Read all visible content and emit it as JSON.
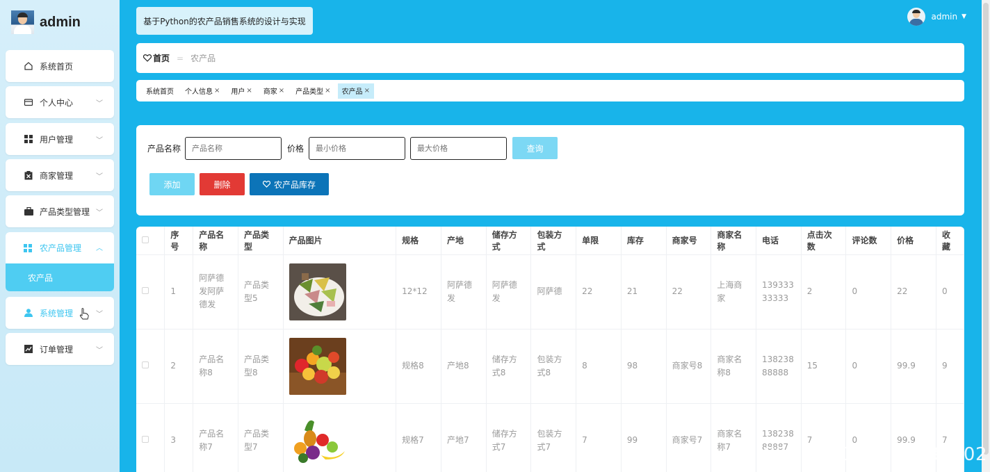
{
  "brand": {
    "name": "admin"
  },
  "app_title": "基于Python的农产品销售系统的设计与实现",
  "user": {
    "name": "admin"
  },
  "sidebar": {
    "items": [
      {
        "label": "系统首页",
        "icon": "home-icon"
      },
      {
        "label": "个人中心",
        "icon": "id-card-icon"
      },
      {
        "label": "用户管理",
        "icon": "grid-icon"
      },
      {
        "label": "商家管理",
        "icon": "clipboard-icon"
      },
      {
        "label": "产品类型管理",
        "icon": "briefcase-icon"
      },
      {
        "label": "农产品管理",
        "icon": "grid-icon",
        "sub": "农产品"
      },
      {
        "label": "系统管理",
        "icon": "person-icon"
      },
      {
        "label": "订单管理",
        "icon": "chart-icon"
      }
    ]
  },
  "breadcrumb": {
    "home": "首页",
    "separator": "〉",
    "current": "农产品"
  },
  "tags": [
    "系统首页",
    "个人信息",
    "用户",
    "商家",
    "产品类型",
    "农产品"
  ],
  "search": {
    "name_label": "产品名称",
    "name_placeholder": "产品名称",
    "price_label": "价格",
    "min_placeholder": "最小价格",
    "max_placeholder": "最大价格",
    "query_button": "查询"
  },
  "actions": {
    "add": "添加",
    "delete": "删除",
    "stock": "农产品库存"
  },
  "table": {
    "columns": [
      "序号",
      "产品名称",
      "产品类型",
      "产品图片",
      "规格",
      "产地",
      "储存方式",
      "包装方式",
      "单限",
      "库存",
      "商家号",
      "商家名称",
      "电话",
      "点击次数",
      "评论数",
      "价格",
      "收藏"
    ],
    "rows": [
      [
        "1",
        "阿萨德发阿萨德发",
        "产品类型5",
        "",
        "12*12",
        "阿萨德发",
        "阿萨德发",
        "阿萨德",
        "22",
        "21",
        "22",
        "上海商家",
        "13933333333",
        "2",
        "0",
        "22",
        "0"
      ],
      [
        "2",
        "产品名称8",
        "产品类型8",
        "",
        "规格8",
        "产地8",
        "储存方式8",
        "包装方式8",
        "8",
        "98",
        "商家号8",
        "商家名称8",
        "13823888888",
        "15",
        "0",
        "99.9",
        "9"
      ],
      [
        "3",
        "产品名称7",
        "产品类型7",
        "",
        "规格7",
        "产地7",
        "储存方式7",
        "包装方式7",
        "7",
        "99",
        "商家号7",
        "商家名称7",
        "13823888887",
        "7",
        "0",
        "99.9",
        "7"
      ]
    ]
  },
  "watermark": "CSDN @QQ2279239102"
}
